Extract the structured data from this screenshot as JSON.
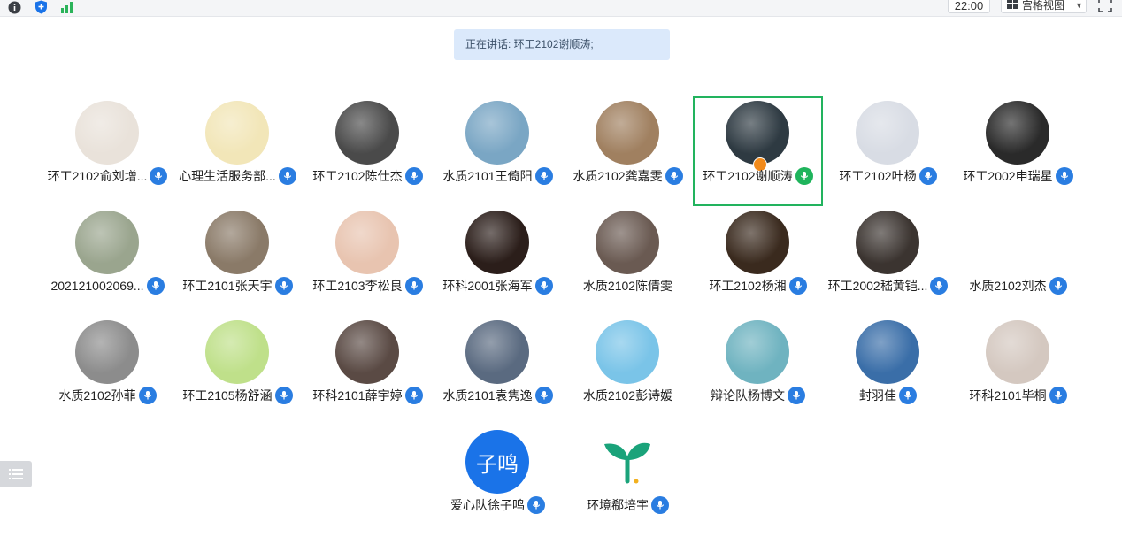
{
  "toolbar": {
    "icons": [
      "info-icon",
      "shield-icon",
      "signal-icon"
    ],
    "timer": "22:00",
    "view_label": "宫格视图",
    "fullscreen_icon": "fullscreen-icon"
  },
  "speaking_banner": {
    "text": "正在讲话: 环工2102谢顺涛;"
  },
  "participants": [
    {
      "name": "环工2102俞刘增...",
      "mic": "blue",
      "avatar_color": "#e9e2da"
    },
    {
      "name": "心理生活服务部...",
      "mic": "blue",
      "avatar_color": "#f2e6b8"
    },
    {
      "name": "环工2102陈仕杰",
      "mic": "blue",
      "avatar_color": "#4a4a4a"
    },
    {
      "name": "水质2101王倚阳",
      "mic": "blue",
      "avatar_color": "#7aa6c4"
    },
    {
      "name": "水质2102龚嘉雯",
      "mic": "blue",
      "avatar_color": "#a08060"
    },
    {
      "name": "环工2102谢顺涛",
      "mic": "green",
      "avatar_color": "#2e3a42",
      "active": true,
      "host": true
    },
    {
      "name": "环工2102叶杨",
      "mic": "blue",
      "avatar_color": "#d8dce4"
    },
    {
      "name": "环工2002申瑞星",
      "mic": "blue",
      "avatar_color": "#2a2a2a"
    },
    {
      "name": "202121002069...",
      "mic": "blue",
      "avatar_color": "#9aa58e"
    },
    {
      "name": "环工2101张天宇",
      "mic": "blue",
      "avatar_color": "#8a7a68"
    },
    {
      "name": "环工2103李松良",
      "mic": "blue",
      "avatar_color": "#e8c4b0"
    },
    {
      "name": "环科2001张海军",
      "mic": "blue",
      "avatar_color": "#2b1e1a"
    },
    {
      "name": "水质2102陈倩雯",
      "mic": "none",
      "avatar_color": "#6a5a52"
    },
    {
      "name": "环工2102杨湘",
      "mic": "blue",
      "avatar_color": "#3a2a1e"
    },
    {
      "name": "环工2002嵇黄铠...",
      "mic": "blue",
      "avatar_color": "#3b3430"
    },
    {
      "name": "水质2102刘杰",
      "mic": "blue",
      "avatar_color": "#ffffff"
    },
    {
      "name": "水质2102孙菲",
      "mic": "blue",
      "avatar_color": "#8c8c8c"
    },
    {
      "name": "环工2105杨舒涵",
      "mic": "blue",
      "avatar_color": "#bfe08a"
    },
    {
      "name": "环科2101薛宇婷",
      "mic": "blue",
      "avatar_color": "#5a4a44"
    },
    {
      "name": "水质2101袁隽逸",
      "mic": "blue",
      "avatar_color": "#5a6a80"
    },
    {
      "name": "水质2102彭诗媛",
      "mic": "none",
      "avatar_color": "#7ac4e8"
    },
    {
      "name": "辩论队杨博文",
      "mic": "blue",
      "avatar_color": "#6fb3c0"
    },
    {
      "name": "封羽佳",
      "mic": "blue",
      "avatar_color": "#3a6ea8"
    },
    {
      "name": "环科2101毕桐",
      "mic": "blue",
      "avatar_color": "#d4c8c0"
    },
    {
      "name": "爱心队徐子鸣",
      "mic": "blue",
      "avatar_color": "#1a73e8",
      "avatar_text": "子鸣"
    },
    {
      "name": "环境郗培宇",
      "mic": "blue",
      "avatar_color": "#ffffff",
      "avatar_icon": "sprout-icon"
    }
  ],
  "colors": {
    "accent": "#2a7de1",
    "active_border": "#22b35e",
    "banner_bg": "#dbe9fb"
  }
}
